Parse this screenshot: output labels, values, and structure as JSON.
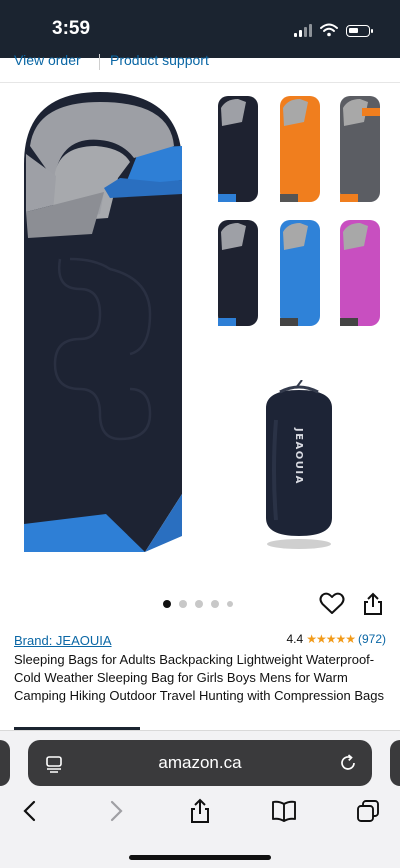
{
  "status_bar": {
    "time": "3:59"
  },
  "top_links": {
    "view_order": "View order",
    "product_support": "Product support"
  },
  "carousel": {
    "dot_count": 5,
    "active_index": 0
  },
  "product": {
    "brand_label": "Brand: JEAOUIA",
    "rating_value": "4.4",
    "stars": "★★★★★",
    "review_count": "(972)",
    "title": "Sleeping Bags for Adults Backpacking Lightweight Waterproof- Cold Weather Sleeping Bag for Girls Boys Mens for Warm Camping Hiking Outdoor Travel Hunting with Compression Bags",
    "stuff_sack_logo_text": "JEAOUIA",
    "variant_colors": [
      "#1e2230",
      "#f07e1e",
      "#5b5d63",
      "#1e2230",
      "#2f82d8",
      "#c84fc0"
    ]
  },
  "safari": {
    "url": "amazon.ca"
  },
  "colors": {
    "link": "#0b67a5",
    "star": "#f29b1a",
    "navy": "#1b2430"
  }
}
